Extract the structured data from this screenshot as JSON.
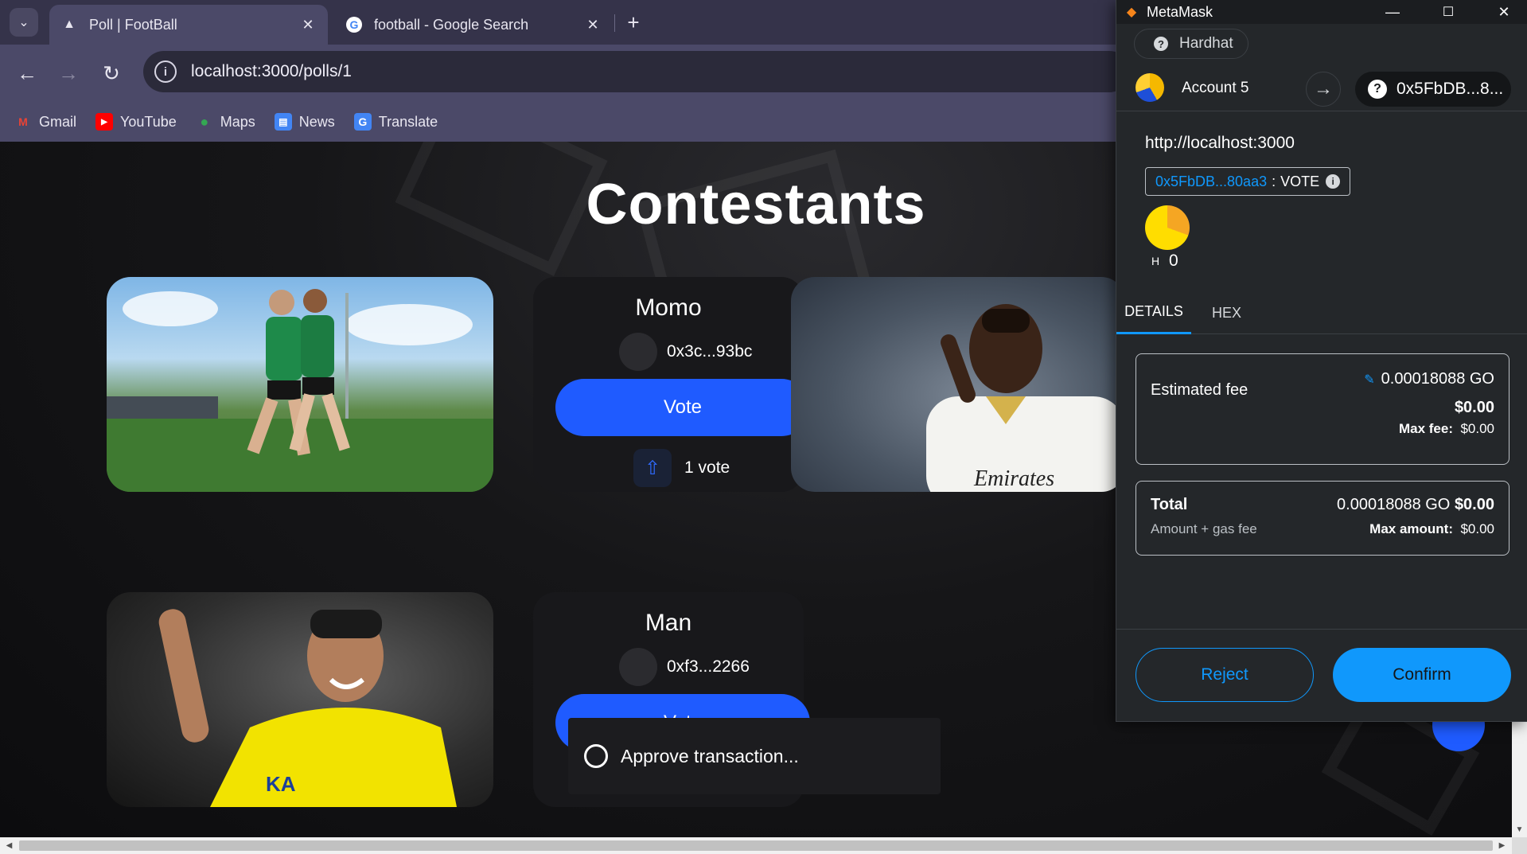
{
  "browser": {
    "tabs": [
      {
        "title": "Poll | FootBall",
        "favicon": "triangle-icon",
        "active": true
      },
      {
        "title": "football - Google Search",
        "favicon": "google-icon",
        "active": false
      }
    ],
    "url": "localhost:3000/polls/1",
    "bookmarks": [
      {
        "label": "Gmail",
        "icon": "gmail-icon",
        "color": "#ea4335",
        "glyph": "M"
      },
      {
        "label": "YouTube",
        "icon": "youtube-icon",
        "color": "#ff0000",
        "glyph": "▶"
      },
      {
        "label": "Maps",
        "icon": "maps-icon",
        "color": "#34a853",
        "glyph": "●"
      },
      {
        "label": "News",
        "icon": "news-icon",
        "color": "#4285f4",
        "glyph": "▤"
      },
      {
        "label": "Translate",
        "icon": "translate-icon",
        "color": "#4285f4",
        "glyph": "G"
      }
    ]
  },
  "page": {
    "heading": "Contestants",
    "contestants": [
      {
        "name": "Momo",
        "address": "0x3c...93bc",
        "vote_label": "Vote",
        "votes": "1 vote"
      },
      {
        "name": "Man",
        "address": "0xf3...2266",
        "vote_label": "Vote"
      }
    ],
    "toast": "Approve transaction..."
  },
  "metamask": {
    "window_title": "MetaMask",
    "network": "Hardhat",
    "account": "Account 5",
    "recipient": "0x5FbDB...8...",
    "origin": "http://localhost:3000",
    "contract": "0x5FbDB...80aa3",
    "method_sep": ":",
    "method": "VOTE",
    "token_symbol": "H",
    "token_amount": "0",
    "tabs": [
      "DETAILS",
      "HEX"
    ],
    "fee": {
      "label": "Estimated fee",
      "amount": "0.00018088 GO",
      "fiat": "$0.00",
      "max_label": "Max fee:",
      "max_value": "$0.00"
    },
    "total": {
      "label": "Total",
      "sub": "Amount + gas fee",
      "amount": "0.00018088 GO",
      "fiat": "$0.00",
      "max_label": "Max amount:",
      "max_value": "$0.00"
    },
    "reject_label": "Reject",
    "confirm_label": "Confirm",
    "colors": {
      "accent": "#1098fc",
      "background": "#24272a"
    }
  },
  "colors": {
    "vote_button": "#1f5bff",
    "tabbar": "#35334a",
    "toolbar": "#4b4968"
  }
}
